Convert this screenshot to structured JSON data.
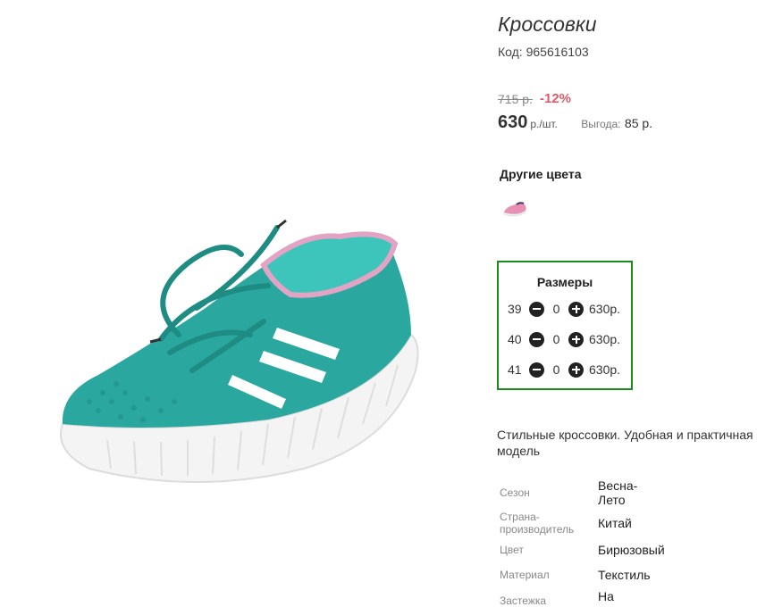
{
  "product": {
    "title": "Кроссовки",
    "code": "Код: 965616103",
    "image_alt": "turquoise-mesh-sneaker",
    "colors": {
      "body": "#2aa89f",
      "sole": "#f4f4f4",
      "trim": "#e3a3c4",
      "stripes": "#ffffff"
    }
  },
  "price": {
    "old": "715 р.",
    "discount": "-12%",
    "current": "630",
    "unit": "р./шт.",
    "savings_label": "Выгода:",
    "savings_value": "85 р."
  },
  "other_colors": {
    "title": "Другие цвета",
    "thumbs": [
      {
        "name": "pink-sneaker"
      }
    ]
  },
  "sizes": {
    "title": "Размеры",
    "rows": [
      {
        "size": "39",
        "qty": "0",
        "price": "630р."
      },
      {
        "size": "40",
        "qty": "0",
        "price": "630р."
      },
      {
        "size": "41",
        "qty": "0",
        "price": "630р."
      }
    ]
  },
  "description": "Стильные кроссовки. Удобная и практичная модель",
  "attributes": [
    {
      "label": "Сезон",
      "value": "Весна-Лето"
    },
    {
      "label": "Страна-производитель",
      "value": "Китай"
    },
    {
      "label": "Цвет",
      "value": "Бирюзовый"
    },
    {
      "label": "Материал",
      "value": "Текстиль"
    },
    {
      "label": "Застежка",
      "value": "На"
    }
  ],
  "accent_colors": {
    "discount": "#e05a6a",
    "sizes_border": "#1a8a1a"
  }
}
